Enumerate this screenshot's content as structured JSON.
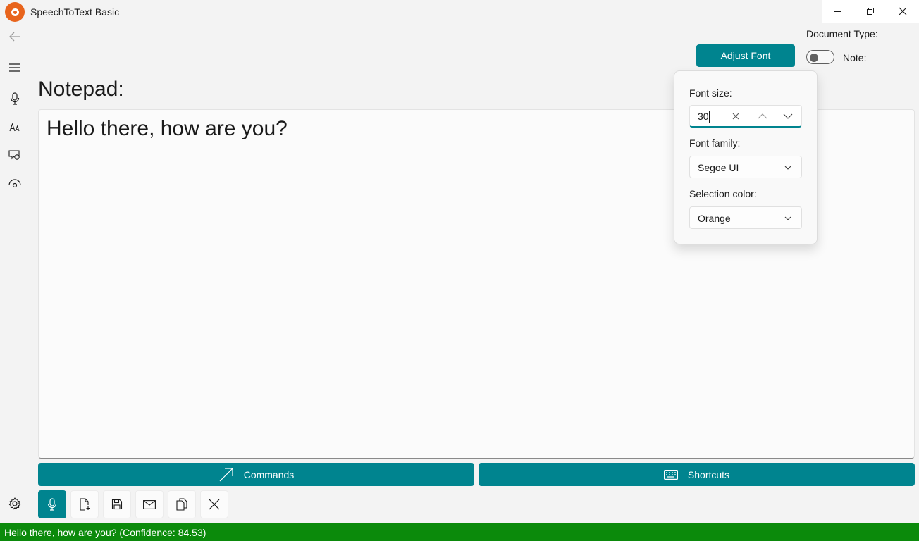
{
  "app": {
    "title": "SpeechToText Basic"
  },
  "window_controls": [
    "minimize-icon",
    "restore-icon",
    "close-icon"
  ],
  "nav": {
    "items": [
      {
        "name": "back",
        "icon": "back-arrow-icon"
      },
      {
        "name": "menu",
        "icon": "hamburger-menu-icon"
      },
      {
        "name": "dictation",
        "icon": "microphone-icon"
      },
      {
        "name": "translate",
        "icon": "translate-icon"
      },
      {
        "name": "read-aloud",
        "icon": "speech-bubble-icon"
      },
      {
        "name": "view",
        "icon": "eye-icon"
      }
    ],
    "settings_icon": "gear-icon"
  },
  "main": {
    "title": "Notepad:",
    "editor_text": "Hello there, how are you?"
  },
  "header": {
    "adjust_font_label": "Adjust Font",
    "document_type_label": "Document Type:",
    "note_label": "Note:",
    "note_toggle_on": false
  },
  "font_flyout": {
    "font_size_label": "Font size:",
    "font_size_value": "30",
    "font_family_label": "Font family:",
    "font_family_value": "Segoe UI",
    "selection_color_label": "Selection color:",
    "selection_color_value": "Orange"
  },
  "actions": {
    "commands_label": "Commands",
    "shortcuts_label": "Shortcuts"
  },
  "toolbar": {
    "buttons": [
      {
        "name": "microphone",
        "icon": "microphone-icon",
        "active": true
      },
      {
        "name": "new-document",
        "icon": "new-document-icon",
        "active": false
      },
      {
        "name": "save",
        "icon": "save-icon",
        "active": false
      },
      {
        "name": "email",
        "icon": "mail-icon",
        "active": false
      },
      {
        "name": "copy",
        "icon": "copy-icon",
        "active": false
      },
      {
        "name": "clear",
        "icon": "close-icon",
        "active": false
      }
    ]
  },
  "status": {
    "text": "Hello there, how are you? (Confidence: 84.53)"
  },
  "colors": {
    "accent": "#00848f",
    "status_bar": "#0b8a0b",
    "logo": "#e8641c",
    "background": "#f3f3f3"
  }
}
